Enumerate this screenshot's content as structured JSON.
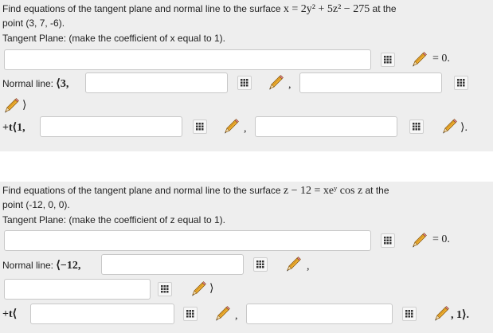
{
  "problem1": {
    "prompt_pre": "Find equations of the tangent plane and normal line to the surface ",
    "equation": "x = 2y² + 5z² − 275",
    "prompt_post": " at the",
    "point_line": "point (3, 7, -6).",
    "tangent_label": "Tangent Plane: (make the coefficient of x equal to 1).",
    "tangent_suffix": "= 0.",
    "normal_label": "Normal line:",
    "normal_open": "⟨3,",
    "comma": ",",
    "close_angle": "⟩",
    "t_open": "+t⟨1,",
    "t_close": "⟩."
  },
  "problem2": {
    "prompt_pre": "Find equations of the tangent plane and normal line to the surface ",
    "equation": "z − 12 = xeʸ cos z",
    "prompt_post": " at the",
    "point_line": "point (-12, 0, 0).",
    "tangent_label": "Tangent Plane: (make the coefficient of z equal to 1).",
    "tangent_suffix": "= 0.",
    "normal_label": "Normal line:",
    "normal_open": "⟨−12,",
    "comma": ",",
    "close_angle": "⟩",
    "t_open": "+t⟨",
    "t_close": ", 1⟩."
  },
  "icons": {
    "matrix": "grid-icon",
    "pencil": "pencil-icon"
  }
}
